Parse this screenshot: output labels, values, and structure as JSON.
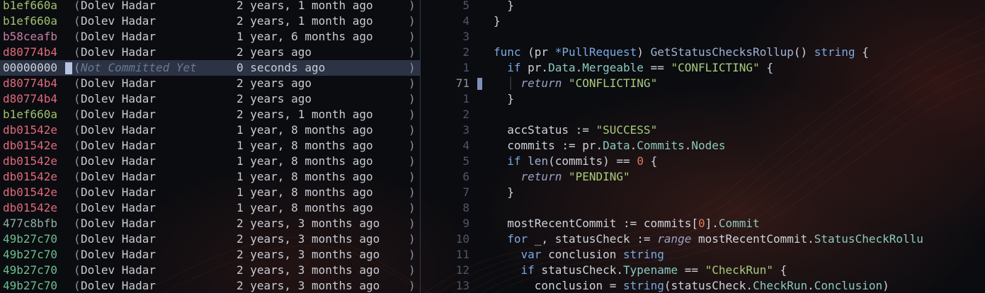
{
  "colors": {
    "hash_b1ef660a": "#9fc16b",
    "hash_b58ceafb": "#c67fa3",
    "hash_d80774b4": "#e06a7c",
    "hash_db01542e": "#e06a7c",
    "hash_477c8bfb": "#8fb0a0",
    "hash_49b27c70": "#6dbf8f",
    "background": "#0b0c10",
    "current_line": "#2b3345"
  },
  "blame": {
    "lines": [
      {
        "hash": "b1ef660a",
        "paren_open": "(",
        "author": "Dolev Hadar",
        "date": "2 years, 1 month ago",
        "paren_close": ")",
        "color": "#9fc16b"
      },
      {
        "hash": "b1ef660a",
        "paren_open": "(",
        "author": "Dolev Hadar",
        "date": "2 years, 1 month ago",
        "paren_close": ")",
        "color": "#9fc16b"
      },
      {
        "hash": "b58ceafb",
        "paren_open": "(",
        "author": "Dolev Hadar",
        "date": "1 year, 6 months ago",
        "paren_close": ")",
        "color": "#c67fa3"
      },
      {
        "hash": "d80774b4",
        "paren_open": "(",
        "author": "Dolev Hadar",
        "date": "2 years ago",
        "paren_close": ")",
        "color": "#e06a7c"
      },
      {
        "hash": "00000000",
        "paren_open": "(",
        "author": "Not Committed Yet",
        "date": "0 seconds ago",
        "paren_close": ")",
        "color": "#cfd3dc",
        "current": true
      },
      {
        "hash": "d80774b4",
        "paren_open": "(",
        "author": "Dolev Hadar",
        "date": "2 years ago",
        "paren_close": ")",
        "color": "#e06a7c"
      },
      {
        "hash": "d80774b4",
        "paren_open": "(",
        "author": "Dolev Hadar",
        "date": "2 years ago",
        "paren_close": ")",
        "color": "#e06a7c"
      },
      {
        "hash": "b1ef660a",
        "paren_open": "(",
        "author": "Dolev Hadar",
        "date": "2 years, 1 month ago",
        "paren_close": ")",
        "color": "#9fc16b"
      },
      {
        "hash": "db01542e",
        "paren_open": "(",
        "author": "Dolev Hadar",
        "date": "1 year, 8 months ago",
        "paren_close": ")",
        "color": "#e06a7c"
      },
      {
        "hash": "db01542e",
        "paren_open": "(",
        "author": "Dolev Hadar",
        "date": "1 year, 8 months ago",
        "paren_close": ")",
        "color": "#e06a7c"
      },
      {
        "hash": "db01542e",
        "paren_open": "(",
        "author": "Dolev Hadar",
        "date": "1 year, 8 months ago",
        "paren_close": ")",
        "color": "#e06a7c"
      },
      {
        "hash": "db01542e",
        "paren_open": "(",
        "author": "Dolev Hadar",
        "date": "1 year, 8 months ago",
        "paren_close": ")",
        "color": "#e06a7c"
      },
      {
        "hash": "db01542e",
        "paren_open": "(",
        "author": "Dolev Hadar",
        "date": "1 year, 8 months ago",
        "paren_close": ")",
        "color": "#e06a7c"
      },
      {
        "hash": "db01542e",
        "paren_open": "(",
        "author": "Dolev Hadar",
        "date": "1 year, 8 months ago",
        "paren_close": ")",
        "color": "#e06a7c"
      },
      {
        "hash": "477c8bfb",
        "paren_open": "(",
        "author": "Dolev Hadar",
        "date": "2 years, 3 months ago",
        "paren_close": ")",
        "color": "#8fb0a0"
      },
      {
        "hash": "49b27c70",
        "paren_open": "(",
        "author": "Dolev Hadar",
        "date": "2 years, 3 months ago",
        "paren_close": ")",
        "color": "#6dbf8f"
      },
      {
        "hash": "49b27c70",
        "paren_open": "(",
        "author": "Dolev Hadar",
        "date": "2 years, 3 months ago",
        "paren_close": ")",
        "color": "#6dbf8f"
      },
      {
        "hash": "49b27c70",
        "paren_open": "(",
        "author": "Dolev Hadar",
        "date": "2 years, 3 months ago",
        "paren_close": ")",
        "color": "#6dbf8f"
      },
      {
        "hash": "49b27c70",
        "paren_open": "(",
        "author": "Dolev Hadar",
        "date": "2 years, 3 months ago",
        "paren_close": ")",
        "color": "#6dbf8f"
      }
    ]
  },
  "code": {
    "lines": [
      {
        "num": "5",
        "tokens": [
          {
            "t": "  }",
            "c": "op"
          }
        ]
      },
      {
        "num": "4",
        "tokens": [
          {
            "t": "}",
            "c": "op"
          }
        ]
      },
      {
        "num": "3",
        "tokens": []
      },
      {
        "num": "2",
        "tokens": [
          {
            "t": "func",
            "c": "kw"
          },
          {
            "t": " (pr ",
            "c": "op"
          },
          {
            "t": "*PullRequest",
            "c": "ty"
          },
          {
            "t": ") ",
            "c": "op"
          },
          {
            "t": "GetStatusChecksRollup",
            "c": "fn"
          },
          {
            "t": "() ",
            "c": "op"
          },
          {
            "t": "string",
            "c": "ty"
          },
          {
            "t": " {",
            "c": "op"
          }
        ]
      },
      {
        "num": "1",
        "tokens": [
          {
            "t": "  ",
            "c": "op"
          },
          {
            "t": "if",
            "c": "kw"
          },
          {
            "t": " pr.",
            "c": "op"
          },
          {
            "t": "Data",
            "c": "field"
          },
          {
            "t": ".",
            "c": "op"
          },
          {
            "t": "Mergeable",
            "c": "field"
          },
          {
            "t": " == ",
            "c": "op"
          },
          {
            "t": "\"CONFLICTING\"",
            "c": "str"
          },
          {
            "t": " {",
            "c": "op"
          }
        ]
      },
      {
        "num": "71",
        "current": true,
        "tokens": [
          {
            "t": "  ",
            "c": "op"
          },
          {
            "t": "│ ",
            "c": "guide"
          },
          {
            "t": "return",
            "c": "ret"
          },
          {
            "t": " ",
            "c": "op"
          },
          {
            "t": "\"CONFLICTING\"",
            "c": "str"
          }
        ]
      },
      {
        "num": "1",
        "tokens": [
          {
            "t": "  }",
            "c": "op"
          }
        ]
      },
      {
        "num": "2",
        "tokens": []
      },
      {
        "num": "3",
        "tokens": [
          {
            "t": "  accStatus := ",
            "c": "op"
          },
          {
            "t": "\"SUCCESS\"",
            "c": "str"
          }
        ]
      },
      {
        "num": "4",
        "tokens": [
          {
            "t": "  commits := pr.",
            "c": "op"
          },
          {
            "t": "Data",
            "c": "field"
          },
          {
            "t": ".",
            "c": "op"
          },
          {
            "t": "Commits",
            "c": "field"
          },
          {
            "t": ".",
            "c": "op"
          },
          {
            "t": "Nodes",
            "c": "field"
          }
        ]
      },
      {
        "num": "5",
        "tokens": [
          {
            "t": "  ",
            "c": "op"
          },
          {
            "t": "if",
            "c": "kw"
          },
          {
            "t": " ",
            "c": "op"
          },
          {
            "t": "len",
            "c": "fn"
          },
          {
            "t": "(commits) == ",
            "c": "op"
          },
          {
            "t": "0",
            "c": "num"
          },
          {
            "t": " {",
            "c": "op"
          }
        ]
      },
      {
        "num": "6",
        "tokens": [
          {
            "t": "    ",
            "c": "op"
          },
          {
            "t": "return",
            "c": "ret"
          },
          {
            "t": " ",
            "c": "op"
          },
          {
            "t": "\"PENDING\"",
            "c": "str"
          }
        ]
      },
      {
        "num": "7",
        "tokens": [
          {
            "t": "  }",
            "c": "op"
          }
        ]
      },
      {
        "num": "8",
        "tokens": []
      },
      {
        "num": "9",
        "tokens": [
          {
            "t": "  mostRecentCommit := commits[",
            "c": "op"
          },
          {
            "t": "0",
            "c": "num"
          },
          {
            "t": "].",
            "c": "op"
          },
          {
            "t": "Commit",
            "c": "field"
          }
        ]
      },
      {
        "num": "10",
        "tokens": [
          {
            "t": "  ",
            "c": "op"
          },
          {
            "t": "for",
            "c": "kw"
          },
          {
            "t": " _, statusCheck := ",
            "c": "op"
          },
          {
            "t": "range",
            "c": "rng"
          },
          {
            "t": " mostRecentCommit.",
            "c": "op"
          },
          {
            "t": "StatusCheckRollu",
            "c": "field"
          }
        ]
      },
      {
        "num": "11",
        "tokens": [
          {
            "t": "    ",
            "c": "op"
          },
          {
            "t": "var",
            "c": "kw"
          },
          {
            "t": " conclusion ",
            "c": "op"
          },
          {
            "t": "string",
            "c": "ty"
          }
        ]
      },
      {
        "num": "12",
        "tokens": [
          {
            "t": "    ",
            "c": "op"
          },
          {
            "t": "if",
            "c": "kw"
          },
          {
            "t": " statusCheck.",
            "c": "op"
          },
          {
            "t": "Typename",
            "c": "field"
          },
          {
            "t": " == ",
            "c": "op"
          },
          {
            "t": "\"CheckRun\"",
            "c": "str"
          },
          {
            "t": " {",
            "c": "op"
          }
        ]
      },
      {
        "num": "13",
        "tokens": [
          {
            "t": "      conclusion = ",
            "c": "op"
          },
          {
            "t": "string",
            "c": "ty"
          },
          {
            "t": "(statusCheck.",
            "c": "op"
          },
          {
            "t": "CheckRun",
            "c": "field"
          },
          {
            "t": ".",
            "c": "op"
          },
          {
            "t": "Conclusion",
            "c": "field"
          },
          {
            "t": ")",
            "c": "op"
          }
        ]
      }
    ]
  }
}
